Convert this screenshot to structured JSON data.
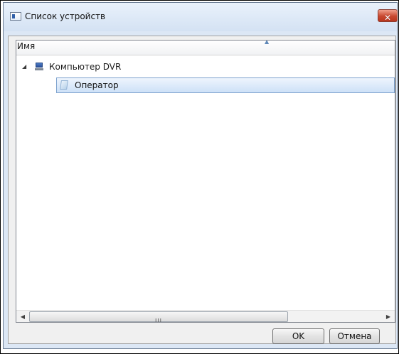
{
  "window": {
    "title": "Список устройств",
    "close_icon": "close-icon"
  },
  "list": {
    "column_header": "Имя",
    "sort_indicator": "▲",
    "rows": [
      {
        "label": "Компьютер DVR",
        "icon": "computer-icon",
        "expanded": true
      },
      {
        "label": "Оператор",
        "icon": "operator-icon",
        "selected": true
      }
    ]
  },
  "scrollbar": {
    "left_arrow": "◀",
    "right_arrow": "▶",
    "grip": "III"
  },
  "buttons": {
    "ok_label": "OK",
    "cancel_label": "Отмена"
  },
  "colors": {
    "titlebar": "#d4e2f3",
    "selection": "#cde1f7",
    "close_button": "#c8482f"
  }
}
